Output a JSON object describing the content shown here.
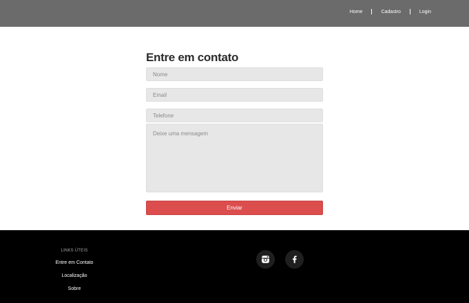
{
  "nav": {
    "items": [
      "Home",
      "Cadastro",
      "Login"
    ]
  },
  "form": {
    "title": "Entre em contato",
    "name_placeholder": "Nome",
    "email_placeholder": "Email",
    "phone_placeholder": "Telefone",
    "message_placeholder": "Deixe uma mensagem",
    "submit_label": "Enviar"
  },
  "footer": {
    "links_title": "LINKS ÚTEIS",
    "links": [
      "Entre em Contato",
      "Localização",
      "Sobre"
    ],
    "social": [
      "instagram-icon",
      "facebook-icon"
    ]
  },
  "colors": {
    "topbar": "#6b6b6b",
    "accent": "#dc4d4d",
    "footer": "#000000",
    "field": "#e7e7e7"
  }
}
